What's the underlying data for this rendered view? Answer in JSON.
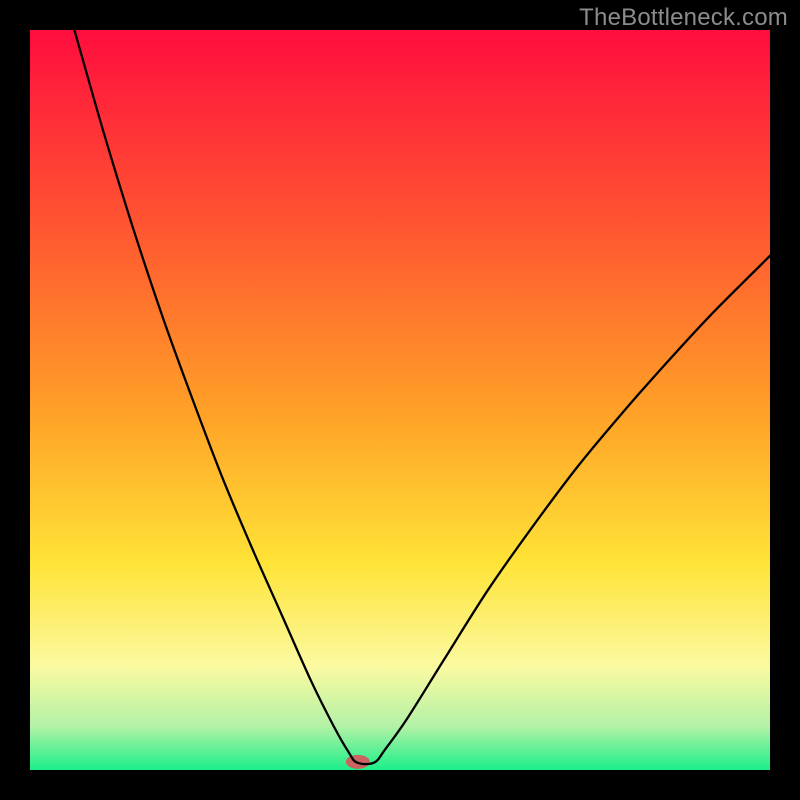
{
  "watermark": "TheBottleneck.com",
  "chart_data": {
    "type": "line",
    "title": "",
    "xlabel": "",
    "ylabel": "",
    "xlim": [
      0,
      100
    ],
    "ylim": [
      0,
      100
    ],
    "grid": false,
    "background": {
      "kind": "vertical-gradient",
      "stops": [
        {
          "pct": 0,
          "color": "#ff0d3e"
        },
        {
          "pct": 28,
          "color": "#ff5a30"
        },
        {
          "pct": 52,
          "color": "#ffa227"
        },
        {
          "pct": 72,
          "color": "#ffe337"
        },
        {
          "pct": 86,
          "color": "#fbfaa1"
        },
        {
          "pct": 94,
          "color": "#b4f2a6"
        },
        {
          "pct": 100,
          "color": "#1bef8a"
        }
      ]
    },
    "marker": {
      "x": 44.3,
      "y": 98.9,
      "color": "#c96460",
      "rx": 12,
      "ry": 7
    },
    "series": [
      {
        "name": "curve",
        "color": "#000000",
        "stroke_width": 2.3,
        "x": [
          6.0,
          10.0,
          14.0,
          18.0,
          22.0,
          26.0,
          30.0,
          34.0,
          38.0,
          41.0,
          43.0,
          44.2,
          46.5,
          48.0,
          51.0,
          56.0,
          62.0,
          68.0,
          74.0,
          80.0,
          86.0,
          92.0,
          98.0,
          100.0
        ],
        "y": [
          0.0,
          14.0,
          27.0,
          39.0,
          50.0,
          60.5,
          70.0,
          79.0,
          88.0,
          94.0,
          97.5,
          99.0,
          99.0,
          97.2,
          93.0,
          85.0,
          75.5,
          67.0,
          59.0,
          51.8,
          45.0,
          38.5,
          32.5,
          30.5
        ]
      }
    ]
  }
}
